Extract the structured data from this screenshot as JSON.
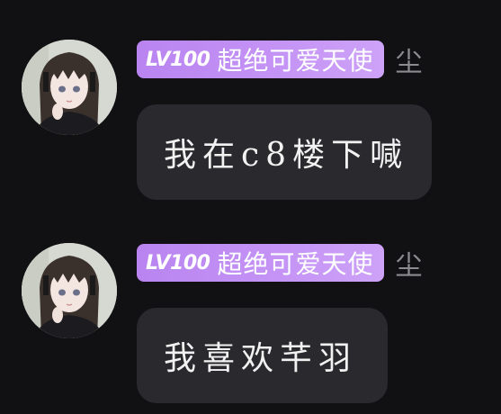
{
  "messages": [
    {
      "level_label": "LV100",
      "title": "超绝可爱天使",
      "name": "尘",
      "text": "我在c8楼下喊"
    },
    {
      "level_label": "LV100",
      "title": "超绝可爱天使",
      "name": "尘",
      "text": "我喜欢芊羽"
    }
  ],
  "colors": {
    "background": "#111114",
    "bubble": "#2a2a2e",
    "badge_gradient_start": "#b984f0",
    "badge_gradient_end": "#cda2f7",
    "name_text": "#8b8b90"
  }
}
